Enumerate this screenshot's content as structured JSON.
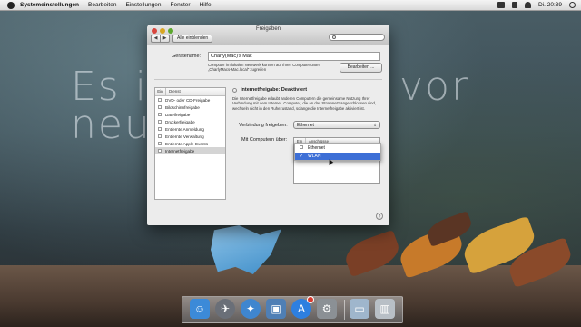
{
  "menubar": {
    "items": [
      "Systemeinstellungen",
      "Bearbeiten",
      "Einstellungen",
      "Fenster",
      "Hilfe"
    ],
    "clock": "Di. 20:39"
  },
  "background_text": {
    "line1a": "Es ist",
    "line1b": "vor",
    "line2": "neur"
  },
  "window": {
    "title": "Freigaben",
    "nav_back": "◀",
    "nav_forward": "▶",
    "show_all": "Alle einblenden",
    "search_placeholder": "",
    "computer_name_label": "Gerätename:",
    "computer_name_value": "Charly(Mac)'s Mac",
    "local_info_line1": "Computer im lokalen Netzwerk können auf Ihren Computer unter",
    "local_info_line2": "„CharlyMacs-Mac.local\" zugreifen",
    "edit_button": "Bearbeiten ...",
    "services_header_on": "Ein",
    "services_header_service": "Dienst",
    "services": [
      {
        "label": "DVD- oder CD-Freigabe",
        "selected": false
      },
      {
        "label": "Bildschirmfreigabe",
        "selected": false
      },
      {
        "label": "Dateifreigabe",
        "selected": false
      },
      {
        "label": "Druckerfreigabe",
        "selected": false
      },
      {
        "label": "Entfernte Anmeldung",
        "selected": false
      },
      {
        "label": "Entfernte Verwaltung",
        "selected": false
      },
      {
        "label": "Entfernte Apple-Events",
        "selected": false
      },
      {
        "label": "Internetfreigabe",
        "selected": true
      }
    ],
    "status": "Internetfreigabe: Deaktiviert",
    "description": "Die Internetfreigabe erlaubt anderen Computern die gemeinsame Nutzung Ihrer Verbindung mit dem Internet. Computer, die an das Stromnetz angeschlossen sind, wechseln nicht in den Ruhezustand, solange die Internetfreigabe aktiviert ist.",
    "share_from_label": "Verbindung freigeben:",
    "share_from_value": "Ethernet",
    "to_computers_label": "Mit Computern über:",
    "ports_header_on": "Ein",
    "ports_header_port": "Anschlüsse",
    "ports": [
      {
        "label": "Ethernet",
        "highlighted": false,
        "checked": false
      },
      {
        "label": "WLAN",
        "highlighted": true,
        "checked": true
      }
    ],
    "help": "?"
  },
  "dock": {
    "apps": [
      {
        "name": "Finder",
        "icon": "finder-icon",
        "color": "#3c8ad8"
      },
      {
        "name": "Launchpad",
        "icon": "launchpad-icon",
        "color": "#6a6f78"
      },
      {
        "name": "Safari",
        "icon": "safari-icon",
        "color": "#3f86cf"
      },
      {
        "name": "Vorschau",
        "icon": "preview-icon",
        "color": "#4f7fb5"
      },
      {
        "name": "App Store",
        "icon": "app-store-icon",
        "color": "#2d7fe0"
      },
      {
        "name": "Systemeinstellungen",
        "icon": "system-preferences-icon",
        "color": "#8b9095"
      },
      {
        "name": "Programme",
        "icon": "folder-icon",
        "color": "#9fb6cc"
      },
      {
        "name": "Papierkorb",
        "icon": "trash-icon",
        "color": "#b8bfc6"
      }
    ]
  }
}
